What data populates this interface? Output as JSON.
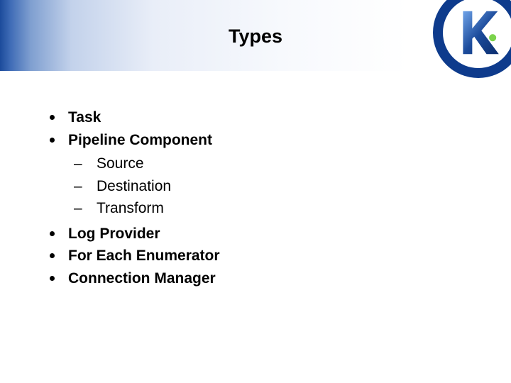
{
  "title": "Types",
  "logo_letter": "K",
  "bullets": [
    {
      "label": "Task"
    },
    {
      "label": "Pipeline Component",
      "subitems": [
        "Source",
        "Destination",
        "Transform"
      ]
    },
    {
      "label": "Log Provider"
    },
    {
      "label": "For Each Enumerator"
    },
    {
      "label": "Connection Manager"
    }
  ]
}
